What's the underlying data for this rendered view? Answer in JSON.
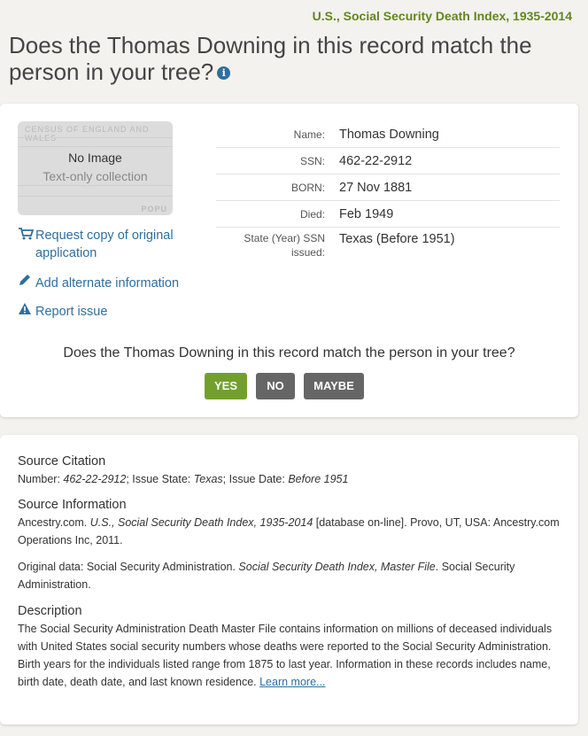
{
  "collection_title": "U.S., Social Security Death Index, 1935-2014",
  "heading": {
    "question": "Does the Thomas Downing in this record match the person in your tree?",
    "info_icon": "i"
  },
  "thumbnail": {
    "bg_text": "CENSUS OF ENGLAND AND WALES",
    "bg_footer": "POPU",
    "no_image": "No Image",
    "text_only": "Text-only collection"
  },
  "actions": {
    "request_copy": "Request copy of original application",
    "add_alternate": "Add alternate information",
    "report_issue": "Report issue"
  },
  "fields": [
    {
      "label": "Name:",
      "value": "Thomas Downing"
    },
    {
      "label": "SSN:",
      "value": "462-22-2912"
    },
    {
      "label": "BORN:",
      "value": "27 Nov 1881"
    },
    {
      "label": "Died:",
      "value": "Feb 1949"
    },
    {
      "label": "State (Year) SSN issued:",
      "value": "Texas (Before 1951)"
    }
  ],
  "match": {
    "question": "Does the Thomas Downing in this record match the person in your tree?",
    "yes": "YES",
    "no": "NO",
    "maybe": "MAYBE"
  },
  "source": {
    "citation_heading": "Source Citation",
    "citation": {
      "number_label": "Number: ",
      "number": "462-22-2912",
      "state_label": "; Issue State: ",
      "state": "Texas",
      "date_label": "; Issue Date: ",
      "date": "Before 1951"
    },
    "info_heading": "Source Information",
    "info": {
      "prefix": "Ancestry.com. ",
      "title": "U.S., Social Security Death Index, 1935-2014",
      "suffix": " [database on-line]. Provo, UT, USA: Ancestry.com Operations Inc, 2011."
    },
    "original": {
      "prefix": "Original data: Social Security Administration. ",
      "title": "Social Security Death Index, Master File",
      "suffix": ". Social Security Administration."
    },
    "description_heading": "Description",
    "description": "The Social Security Administration Death Master File contains information on millions of deceased individuals with United States social security numbers whose deaths were reported to the Social Security Administration. Birth years for the individuals listed range from 1875 to last year. Information in these records includes name, birth date, death date, and last known residence. ",
    "learn_more": "Learn more..."
  },
  "colors": {
    "accent_green": "#73a02c",
    "title_green": "#62861f",
    "link_blue": "#2e6f9e",
    "button_gray": "#666666"
  }
}
